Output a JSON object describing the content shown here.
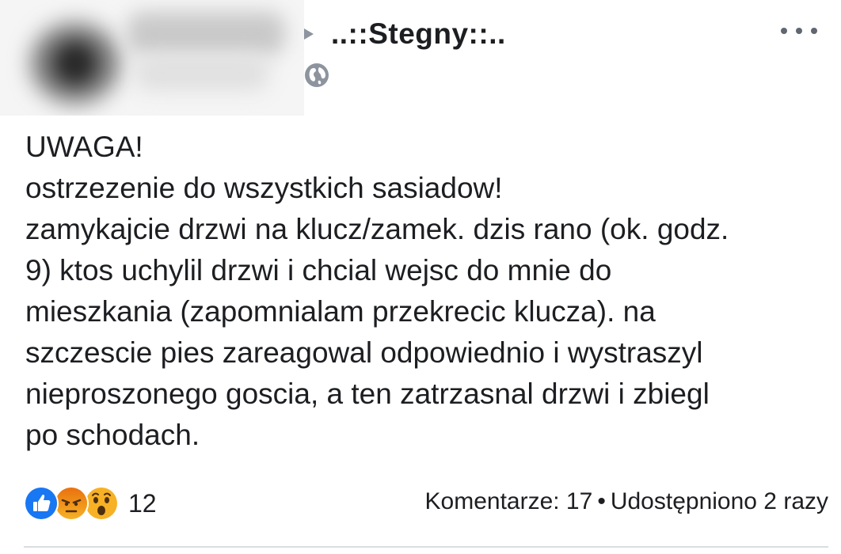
{
  "header": {
    "group_name": "..::Stegny::..",
    "icons": {
      "arrow": "caret-right-icon",
      "privacy": "globe-icon",
      "menu": "more-options-icon"
    }
  },
  "post": {
    "lines": [
      "UWAGA!",
      "ostrzezenie do wszystkich sasiadow!",
      "zamykajcie drzwi na klucz/zamek. dzis rano (ok. godz.",
      "9) ktos uchylil drzwi i chcial wejsc do mnie do",
      "mieszkania (zapomnialam przekrecic klucza). na",
      "szczescie pies zareagowal odpowiednio i wystraszyl",
      "nieproszonego goscia, a ten zatrzasnal drzwi i zbiegl",
      "po schodach."
    ]
  },
  "footer": {
    "reactions": [
      "like-reaction-icon",
      "angry-reaction-icon",
      "wow-reaction-icon"
    ],
    "reaction_count": "12",
    "comments": "Komentarze: 17",
    "separator": "•",
    "shares": "Udostępniono 2 razy"
  },
  "colors": {
    "text": "#1c1e21",
    "secondary": "#606770",
    "like_blue": "#1877f2",
    "reaction_yellow": "#f7b125",
    "angry_orange": "#e9710f"
  }
}
